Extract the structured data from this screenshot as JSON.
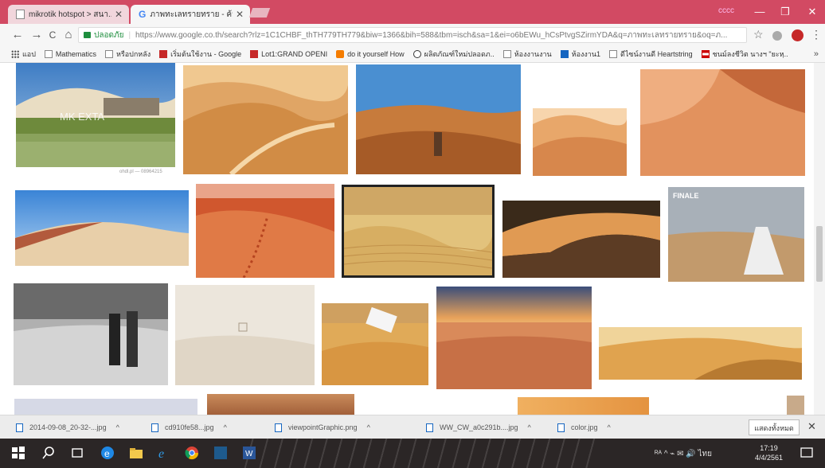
{
  "window": {
    "tabs": [
      {
        "title": "mikrotik hotspot > สนา..",
        "active": false
      },
      {
        "title": "ภาพทะเลทรายทราย - ค้นหา..",
        "active": true
      }
    ],
    "user_label": "cccc",
    "controls": {
      "minimize": "—",
      "maximize": "❐",
      "close": "✕"
    }
  },
  "toolbar": {
    "back": "←",
    "forward": "→",
    "reload": "C",
    "home": "⌂",
    "secure_label": "ปลอดภัย",
    "url": "https://www.google.co.th/search?rlz=1C1CHBF_thTH779TH779&biw=1366&bih=588&tbm=isch&sa=1&ei=o6bEWu_hCsPtvgSZirmYDA&q=ภาพทะเลทรายทราย&oq=ภ...",
    "star": "☆",
    "menu": "⋮"
  },
  "bookmarks": {
    "items": [
      {
        "label": "แอป",
        "icon": "apps-icon",
        "style": "apps"
      },
      {
        "label": "Mathematics",
        "icon": "page-icon",
        "style": ""
      },
      {
        "label": "หรือปกหลัง",
        "icon": "page-icon",
        "style": ""
      },
      {
        "label": "เริ่มต้นใช้งาน - Google",
        "icon": "google-plus-icon",
        "style": "red"
      },
      {
        "label": "Lot1:GRAND OPENI",
        "icon": "lot-icon",
        "style": "red"
      },
      {
        "label": "do it yourself How",
        "icon": "blogger-icon",
        "style": "orange"
      },
      {
        "label": "ผลิตภัณฑ์ใหม่ปลอดภ..",
        "icon": "wordpress-icon",
        "style": "wp"
      },
      {
        "label": "ห้องงานงาน",
        "icon": "page-icon",
        "style": ""
      },
      {
        "label": "ห้องงาน1",
        "icon": "flag-icon",
        "style": "blue"
      },
      {
        "label": "ดีไซน์งานดี Heartstring",
        "icon": "page-icon",
        "style": ""
      },
      {
        "label": "ชนม์ลงชีวิต นางฯ \"ยะหฺ..",
        "icon": "thai-flag-icon",
        "style": "flag"
      }
    ],
    "more": "»"
  },
  "images": {
    "first_caption": "ohdl.pl — 08964215",
    "watermark": "MK EXTA",
    "finale_label": "FINALE"
  },
  "downloads": {
    "items": [
      {
        "name": "2014-09-08_20-32-...jpg"
      },
      {
        "name": "cd910fe58...jpg"
      },
      {
        "name": "viewpointGraphic.png"
      },
      {
        "name": "WW_CW_a0c291b....jpg"
      },
      {
        "name": "color.jpg"
      }
    ],
    "show_all": "แสดงทั้งหมด",
    "close": "✕"
  },
  "taskbar": {
    "tray_text": "ᴿᴬ ^ ⌁ ✉ 🔊 ไทย",
    "time": "17:19",
    "date": "4/4/2561"
  },
  "colors": {
    "titlebar": "#d24a63",
    "taskbar": "#2b2626",
    "accent_blue": "#1565c0"
  }
}
